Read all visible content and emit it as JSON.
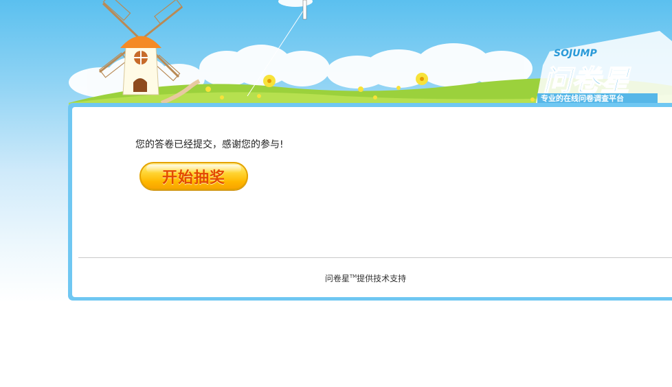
{
  "header": {
    "brand_en": "SOJUMP",
    "brand_cn": "问卷星",
    "tagline": "专业的在线问卷调查平台"
  },
  "main": {
    "message": "您的答卷已经提交，感谢您的参与!",
    "lottery_button_label": "开始抽奖"
  },
  "footer": {
    "brand": "问卷星",
    "trademark": "TM",
    "support_text": "提供技术支持"
  },
  "colors": {
    "sky_blue": "#5bc0ef",
    "panel_border": "#6fc7f2",
    "grass_green": "#9bd13c",
    "button_yellow": "#ffd83a",
    "button_text": "#e34a00"
  }
}
